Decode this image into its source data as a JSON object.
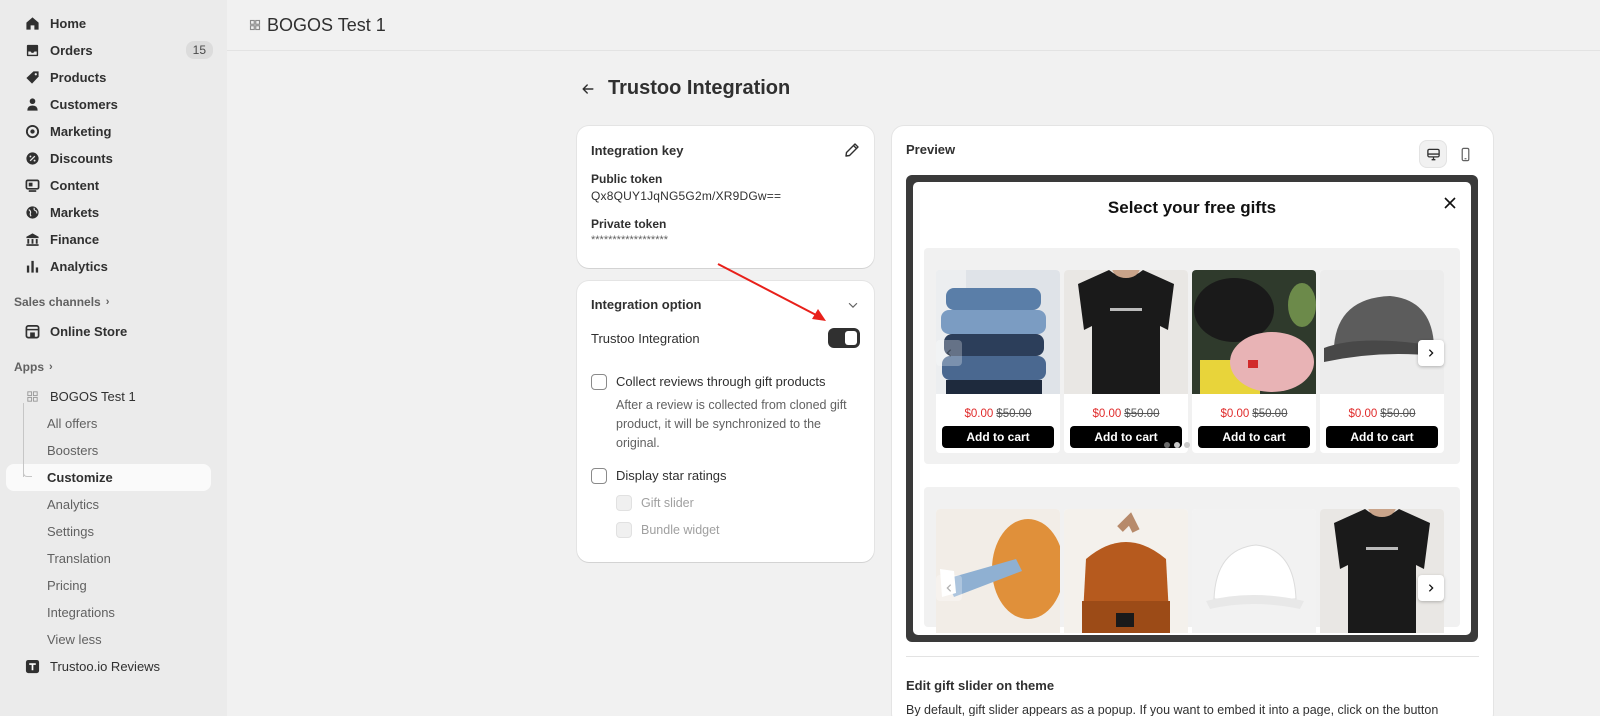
{
  "sidebar": {
    "items": [
      {
        "label": "Home",
        "icon": "home-icon"
      },
      {
        "label": "Orders",
        "icon": "orders-icon",
        "badge": "15"
      },
      {
        "label": "Products",
        "icon": "tag-icon"
      },
      {
        "label": "Customers",
        "icon": "person-icon"
      },
      {
        "label": "Marketing",
        "icon": "target-icon"
      },
      {
        "label": "Discounts",
        "icon": "discount-icon"
      },
      {
        "label": "Content",
        "icon": "content-icon"
      },
      {
        "label": "Markets",
        "icon": "globe-icon"
      },
      {
        "label": "Finance",
        "icon": "bank-icon"
      },
      {
        "label": "Analytics",
        "icon": "bar-chart-icon"
      }
    ],
    "sales_channels_label": "Sales channels",
    "online_store_label": "Online Store",
    "apps_label": "Apps",
    "app_name": "BOGOS Test 1",
    "app_sub_items": [
      "All offers",
      "Boosters",
      "Customize",
      "Analytics",
      "Settings",
      "Translation",
      "Pricing",
      "Integrations",
      "View less"
    ],
    "active_sub_item": "Customize",
    "trustoo_label": "Trustoo.io Reviews"
  },
  "topbar": {
    "title": "BOGOS Test 1"
  },
  "page": {
    "title": "Trustoo Integration"
  },
  "integration_key": {
    "title": "Integration key",
    "public_token_label": "Public token",
    "public_token_value": "Qx8QUY1JqNG5G2m/XR9DGw==",
    "private_token_label": "Private token",
    "private_token_value": "******************"
  },
  "integration_option": {
    "title": "Integration option",
    "toggle_label": "Trustoo Integration",
    "toggle_on": true,
    "collect_reviews_label": "Collect reviews through gift products",
    "collect_reviews_desc": "After a review is collected from cloned gift product, it will be synchronized to the original.",
    "display_ratings_label": "Display star ratings",
    "gift_slider_label": "Gift slider",
    "bundle_widget_label": "Bundle widget"
  },
  "preview": {
    "title": "Preview",
    "popup_title": "Select your free gifts",
    "products_row1": [
      {
        "now": "$0.00",
        "was": "$50.00",
        "button": "Add to cart"
      },
      {
        "now": "$0.00",
        "was": "$50.00",
        "button": "Add to cart"
      },
      {
        "now": "$0.00",
        "was": "$50.00",
        "button": "Add to cart"
      },
      {
        "now": "$0.00",
        "was": "$50.00",
        "button": "Add to cart"
      }
    ],
    "edit_title": "Edit gift slider on theme",
    "edit_desc": "By default, gift slider appears as a popup. If you want to embed it into a page, click on the button"
  },
  "colors": {
    "accent_red": "#e02b2b",
    "toggle_dark": "#303030",
    "annotation_arrow": "#e8201a"
  }
}
